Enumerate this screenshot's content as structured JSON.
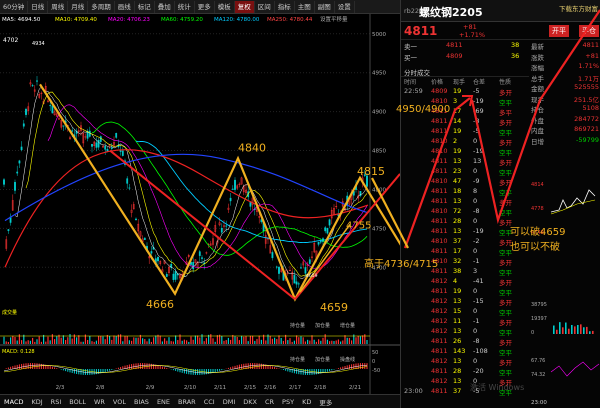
{
  "toolbar": {
    "items": [
      "60分钟",
      "日线",
      "周线",
      "月线",
      "多周期",
      "画线",
      "标记",
      "叠加",
      "统计",
      "更多",
      "模板",
      "复权",
      "区间",
      "指标",
      "主图",
      "副图",
      "设置"
    ],
    "active_index": 11
  },
  "ma_legend": {
    "ma5": "MA5: 4694.50",
    "ma10": "MA10: 4709.40",
    "ma20": "MA20: 4706.23",
    "ma60": "MA60: 4759.20",
    "ma120": "MA120: 4780.00",
    "ma250": "MA250: 4780.44",
    "extra": "设置平移量"
  },
  "price_axis": [
    "5000",
    "4950",
    "4900",
    "4850",
    "4800",
    "4750",
    "4700"
  ],
  "annotations": {
    "left_top": "4702",
    "peak": "4934",
    "mid_high": "4840",
    "low1": "4666",
    "low2": "4659",
    "right_level": "4815",
    "right_low": "4755",
    "target": "4950/4900",
    "text_right1": "高于4736/4715",
    "text_right2": "可以破4659",
    "text_right3": "也可以不破",
    "small_low": "4659"
  },
  "sub_panel": {
    "vol_label": "成交量",
    "vol_tabs": [
      "持仓量",
      "加仓量",
      "增仓量"
    ],
    "macd_label": "MACD: 0.128",
    "macd_tabs": [
      "持仓量",
      "加仓量",
      "操盘线"
    ],
    "macd_axis": [
      "50",
      "0",
      "-50"
    ]
  },
  "date_axis": [
    "2/3",
    "2/8",
    "2/9",
    "2/10",
    "2/11",
    "2/15",
    "2/16",
    "2/17",
    "2/18",
    "2/21"
  ],
  "bottom_tabs": [
    "MACD",
    "KDJ",
    "RSI",
    "BOLL",
    "WR",
    "VOL",
    "BIAS",
    "ENE",
    "BRAR",
    "CCI",
    "DMI",
    "DKX",
    "CR",
    "PSY",
    "KD",
    "更多"
  ],
  "right_panel": {
    "code": "rb2205",
    "name": "螺纹钢2205",
    "top_btn": "下载东方财富",
    "price": "4811",
    "chg_abs": "+81",
    "chg_pct": "+1.71%",
    "open_btn": "开平",
    "close_btn": "平仓",
    "order_rows": [
      {
        "label": "卖一",
        "price": "4811",
        "vol": "38"
      },
      {
        "label": "买一",
        "price": "4809",
        "vol": "36"
      }
    ],
    "stats": [
      {
        "k": "最新",
        "v": "4811"
      },
      {
        "k": "涨跌",
        "v": "+81"
      },
      {
        "k": "涨幅",
        "v": "1.71%"
      },
      {
        "k": "总手",
        "v": "1.71万"
      },
      {
        "k": "金额",
        "v": "525555"
      },
      {
        "k": "现手",
        "v": "251.5亿"
      },
      {
        "k": "持仓",
        "v": "5108"
      },
      {
        "k": "外盘",
        "v": "284772"
      },
      {
        "k": "内盘",
        "v": "869721"
      },
      {
        "k": "日增",
        "v": "-59799"
      }
    ],
    "tick_title": "分时成交",
    "tick_header": [
      "时间",
      "价格",
      "现手",
      "仓差",
      "性质"
    ],
    "ticks": [
      [
        "22:59",
        "4809",
        "19",
        "-5",
        "多开"
      ],
      [
        "",
        "4810",
        "3",
        "-19",
        "空平"
      ],
      [
        "",
        "4811",
        "17",
        "-69",
        "多平"
      ],
      [
        "",
        "4811",
        "14",
        "-8",
        "多开"
      ],
      [
        "",
        "4811",
        "19",
        "-5",
        "空平"
      ],
      [
        "",
        "4810",
        "2",
        "0",
        "多开"
      ],
      [
        "",
        "4810",
        "19",
        "-19",
        "空平"
      ],
      [
        "",
        "4811",
        "13",
        "13",
        "多开"
      ],
      [
        "",
        "4811",
        "23",
        "0",
        "空平"
      ],
      [
        "",
        "4810",
        "47",
        "-9",
        "多开"
      ],
      [
        "",
        "4811",
        "18",
        "8",
        "空平"
      ],
      [
        "",
        "4811",
        "13",
        "0",
        "多开"
      ],
      [
        "",
        "4810",
        "72",
        "-8",
        "空平"
      ],
      [
        "",
        "4811",
        "28",
        "0",
        "多开"
      ],
      [
        "",
        "4811",
        "13",
        "-19",
        "空平"
      ],
      [
        "",
        "4810",
        "37",
        "-2",
        "多开"
      ],
      [
        "",
        "4811",
        "17",
        "0",
        "空平"
      ],
      [
        "",
        "4810",
        "32",
        "-1",
        "多开"
      ],
      [
        "",
        "4811",
        "38",
        "3",
        "空平"
      ],
      [
        "",
        "4812",
        "4",
        "-41",
        "多开"
      ],
      [
        "",
        "4811",
        "19",
        "0",
        "空平"
      ],
      [
        "",
        "4812",
        "13",
        "-15",
        "多开"
      ],
      [
        "",
        "4812",
        "15",
        "0",
        "空平"
      ],
      [
        "",
        "4812",
        "11",
        "-1",
        "多开"
      ],
      [
        "",
        "4812",
        "13",
        "0",
        "空平"
      ],
      [
        "",
        "4811",
        "26",
        "-8",
        "多开"
      ],
      [
        "",
        "4811",
        "143",
        "-108",
        "空平"
      ],
      [
        "",
        "4812",
        "13",
        "0",
        "多开"
      ],
      [
        "",
        "4811",
        "28",
        "-20",
        "空平"
      ],
      [
        "",
        "4812",
        "13",
        "0",
        "多开"
      ],
      [
        "23:00",
        "4811",
        "37",
        "-5",
        "空平"
      ]
    ],
    "mini_axis": [
      "4814",
      "4778",
      "4749"
    ],
    "mini_vol_axis": [
      "38795",
      "19397",
      "0"
    ],
    "mini_rsi_axis": [
      "67.76",
      "74.32"
    ],
    "mini_time": "23:00"
  },
  "watermark": "激活 Windows"
}
